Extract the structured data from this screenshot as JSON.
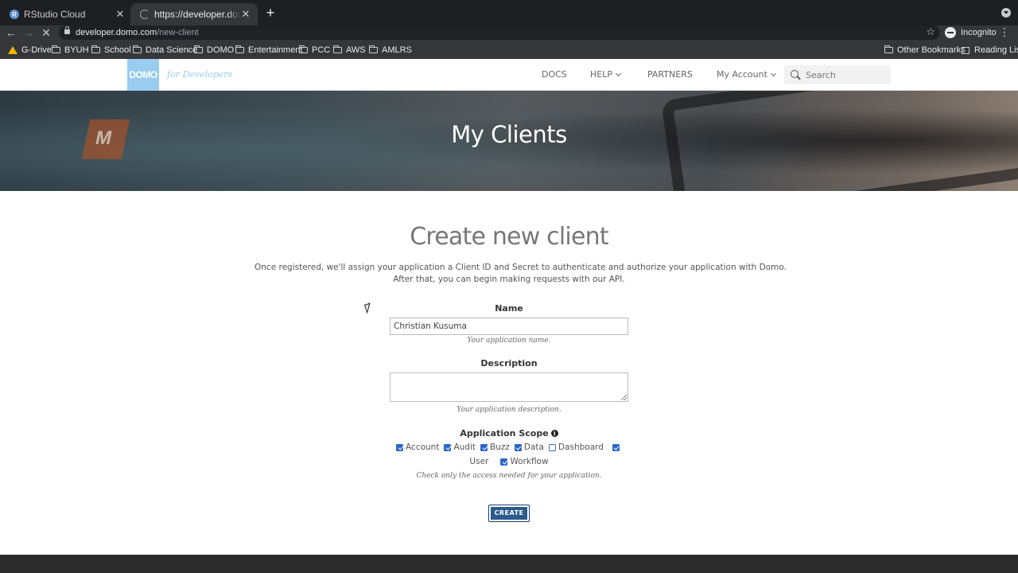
{
  "browser": {
    "tabs": [
      {
        "title": "RStudio Cloud",
        "favicon": "R",
        "active": false
      },
      {
        "title": "https://developer.domo.com/new-client",
        "active": true
      }
    ],
    "close_glyph": "✕",
    "new_tab_glyph": "+",
    "url_host": "developer.domo.com",
    "url_path": "/new-client",
    "profile_label": "Incognito",
    "bookmarks": [
      {
        "label": "G-Drive",
        "icon": "gdrive-icon"
      },
      {
        "label": "BYUH",
        "icon": "folder-icon"
      },
      {
        "label": "School",
        "icon": "folder-icon"
      },
      {
        "label": "Data Science",
        "icon": "folder-icon"
      },
      {
        "label": "DOMO",
        "icon": "folder-icon"
      },
      {
        "label": "Entertainment",
        "icon": "folder-icon"
      },
      {
        "label": "PCC",
        "icon": "folder-icon"
      },
      {
        "label": "AWS",
        "icon": "folder-icon"
      },
      {
        "label": "AMLRS",
        "icon": "folder-icon"
      }
    ],
    "other_bookmarks": "Other Bookmarks",
    "reading_list": "Reading List"
  },
  "site": {
    "logo_text": "DOMO",
    "logo_tagline": "for Developers",
    "nav": {
      "docs": "DOCS",
      "help": "HELP",
      "partners": "PARTNERS",
      "account": "My Account"
    },
    "search_placeholder": "Search",
    "accent_color": "#99ccee"
  },
  "hero": {
    "title": "My Clients"
  },
  "form": {
    "title": "Create new client",
    "intro_line1": "Once registered, we'll assign your application a Client ID and Secret to authenticate and authorize your application with Domo.",
    "intro_line2": "After that, you can begin making requests with our API.",
    "name_label": "Name",
    "name_value": "Christian Kusuma",
    "name_help": "Your application name.",
    "description_label": "Description",
    "description_value": "",
    "description_help": "Your application description.",
    "scope_label": "Application Scope",
    "scopes_row1": [
      {
        "label": "Account",
        "checked": true
      },
      {
        "label": "Audit",
        "checked": true
      },
      {
        "label": "Buzz",
        "checked": true
      },
      {
        "label": "Data",
        "checked": true
      },
      {
        "label": "Dashboard",
        "checked": false
      },
      {
        "label": "",
        "checked": true
      }
    ],
    "scopes_row2": [
      {
        "label": "User",
        "checked": null
      },
      {
        "label": "Workflow",
        "checked": true
      }
    ],
    "scope_help": "Check only the access needed for your application.",
    "create_label": "CREATE",
    "button_color": "#2a5b8c"
  }
}
